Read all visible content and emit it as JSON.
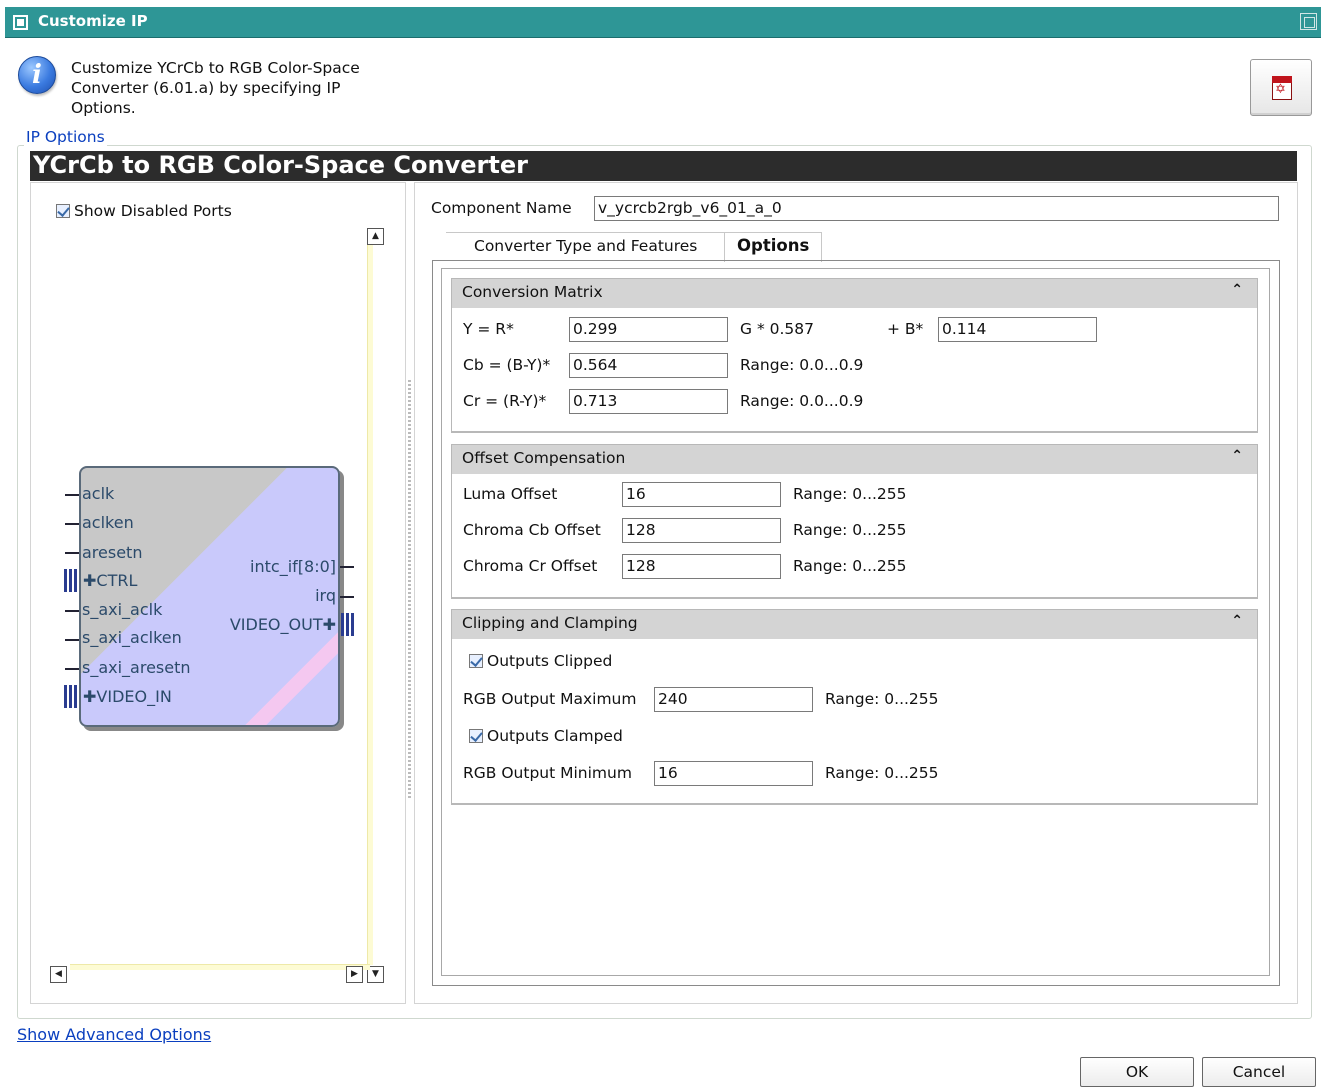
{
  "window": {
    "title": "Customize IP"
  },
  "header": {
    "description": "Customize YCrCb to RGB Color-Space Converter (6.01.a) by specifying IP Options."
  },
  "ip_options": {
    "group_label": "IP Options",
    "banner": "YCrCb to RGB Color-Space Converter"
  },
  "left_panel": {
    "show_disabled_ports": {
      "label": "Show Disabled Ports",
      "checked": true
    },
    "block": {
      "left_ports": [
        "aclk",
        "aclken",
        "aresetn",
        "CTRL",
        "s_axi_aclk",
        "s_axi_aclken",
        "s_axi_aresetn",
        "VIDEO_IN"
      ],
      "right_ports": [
        "intc_if[8:0]",
        "irq",
        "VIDEO_OUT"
      ]
    }
  },
  "component": {
    "label": "Component Name",
    "value": "v_ycrcb2rgb_v6_01_a_0"
  },
  "tabs": [
    {
      "label": "Converter Type and Features",
      "active": false
    },
    {
      "label": "Options",
      "active": true
    }
  ],
  "conversion_matrix": {
    "title": "Conversion Matrix",
    "y_label": "Y = R*",
    "y_r": "0.299",
    "g_label": "G * 0.587",
    "b_label": "+ B*",
    "y_b": "0.114",
    "cb_label": "Cb = (B-Y)*",
    "cb_value": "0.564",
    "cb_range": "Range: 0.0...0.9",
    "cr_label": "Cr = (R-Y)*",
    "cr_value": "0.713",
    "cr_range": "Range: 0.0...0.9"
  },
  "offset_compensation": {
    "title": "Offset Compensation",
    "luma_label": "Luma Offset",
    "luma_value": "16",
    "luma_range": "Range: 0...255",
    "cb_label": "Chroma Cb Offset",
    "cb_value": "128",
    "cb_range": "Range: 0...255",
    "cr_label": "Chroma Cr Offset",
    "cr_value": "128",
    "cr_range": "Range: 0...255"
  },
  "clipping_clamping": {
    "title": "Clipping and Clamping",
    "clipped_label": "Outputs Clipped",
    "clipped_checked": true,
    "max_label": "RGB Output Maximum",
    "max_value": "240",
    "max_range": "Range: 0...255",
    "clamped_label": "Outputs Clamped",
    "clamped_checked": true,
    "min_label": "RGB Output Minimum",
    "min_value": "16",
    "min_range": "Range: 0...255"
  },
  "footer": {
    "advanced_link": "Show Advanced Options",
    "ok": "OK",
    "cancel": "Cancel"
  }
}
